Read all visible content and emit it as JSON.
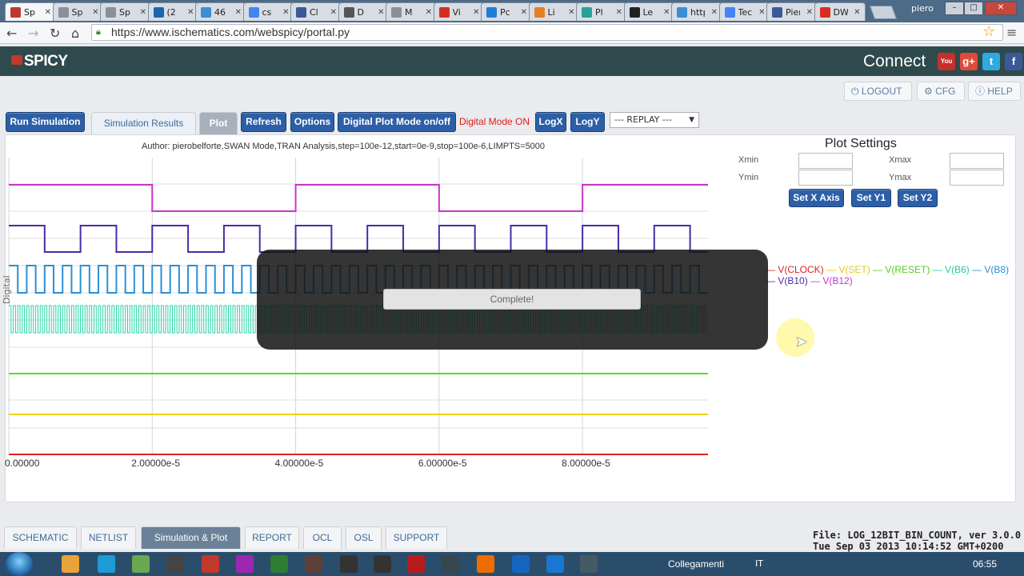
{
  "browser": {
    "tabs": [
      {
        "label": "Sp",
        "color": "#c0392b",
        "active": true
      },
      {
        "label": "Sp",
        "color": "#8a9099"
      },
      {
        "label": "Sp",
        "color": "#8a9099"
      },
      {
        "label": "(2",
        "color": "#1a66b3"
      },
      {
        "label": "46",
        "color": "#3b8ed6"
      },
      {
        "label": "cs",
        "color": "#4285f4"
      },
      {
        "label": "Cl",
        "color": "#3b5998"
      },
      {
        "label": "D",
        "color": "#555555"
      },
      {
        "label": "M",
        "color": "#8a9099"
      },
      {
        "label": "Vi",
        "color": "#d62d20"
      },
      {
        "label": "Pc",
        "color": "#1c7ed6"
      },
      {
        "label": "Li",
        "color": "#e67e22"
      },
      {
        "label": "Pl",
        "color": "#2aa198"
      },
      {
        "label": "Le",
        "color": "#222222"
      },
      {
        "label": "http:",
        "color": "#3b8ed6"
      },
      {
        "label": "Tech",
        "color": "#4285f4"
      },
      {
        "label": "Pierc",
        "color": "#3b5998"
      },
      {
        "label": "DWS",
        "color": "#d62d20"
      }
    ],
    "user": "piero",
    "url": "https://www.ischematics.com/webspicy/portal.py"
  },
  "app": {
    "logo": "SPICY",
    "connect": "Connect",
    "social": [
      {
        "label": "You",
        "color": "#c4302b"
      },
      {
        "label": "g+",
        "color": "#dd4b39"
      },
      {
        "label": "t",
        "color": "#2fa9e0"
      },
      {
        "label": "f",
        "color": "#3b5998"
      }
    ],
    "logout": "LOGOUT",
    "cfg": "CFG",
    "help": "HELP"
  },
  "toolbar": {
    "run": "Run Simulation",
    "results": "Simulation Results",
    "plot": "Plot",
    "refresh": "Refresh",
    "options": "Options",
    "digital": "Digital Plot Mode on/off",
    "digital_status": "Digital Mode ON",
    "logx": "LogX",
    "logy": "LogY",
    "replay": "--- REPLAY ---"
  },
  "plot": {
    "author": "Author: pierobelforte,SWAN Mode,TRAN Analysis,step=100e-12,start=0e-9,stop=100e-6,LIMPTS=5000",
    "ylabel": "Digital",
    "complete": "Complete!"
  },
  "chart_data": {
    "type": "line",
    "title": "",
    "ylabel": "Digital",
    "xlim": [
      0,
      9.75e-05
    ],
    "x_ticks": [
      "0.00000",
      "2.00000e-5",
      "4.00000e-5",
      "6.00000e-5",
      "8.00000e-5"
    ],
    "x_tick_values": [
      0,
      2e-05,
      4e-05,
      6e-05,
      8e-05
    ],
    "series": [
      {
        "name": "V(B12)",
        "color": "#cc33cc",
        "half_period": 2e-05,
        "start_high": true,
        "band": 0
      },
      {
        "name": "V(B10)",
        "color": "#4b2aa8",
        "half_period": 5e-06,
        "start_high": true,
        "band": 1
      },
      {
        "name": "V(B8)",
        "color": "#2b8fd6",
        "half_period": 1.25e-06,
        "start_high": true,
        "band": 2
      },
      {
        "name": "V(B6)",
        "color": "#27d3a3",
        "half_period": 3.125e-07,
        "start_high": true,
        "band": 3
      },
      {
        "name": "V(RESET)",
        "color": "#55dd22",
        "level": "high",
        "band": 4
      },
      {
        "name": "V(SET)",
        "color": "#e8d21a",
        "level": "high",
        "band": 5
      },
      {
        "name": "V(CLOCK)",
        "color": "#dd2222",
        "level": "low",
        "band": 6
      }
    ],
    "grid": true,
    "legend_position": "right"
  },
  "settings": {
    "title": "Plot Settings",
    "xmin_label": "Xmin",
    "xmax_label": "Xmax",
    "ymin_label": "Ymin",
    "ymax_label": "Ymax",
    "set_x": "Set X Axis",
    "set_y1": "Set Y1",
    "set_y2": "Set Y2"
  },
  "legend": {
    "row1": [
      {
        "text": "V(CLOCK)",
        "color": "#dd2222"
      },
      {
        "text": "V(SET)",
        "color": "#e8c81a"
      },
      {
        "text": "V(RESET)",
        "color": "#55cc22"
      },
      {
        "text": "V(B6)",
        "color": "#27c9a0"
      },
      {
        "text": "V(B8)",
        "color": "#2b8fd6"
      }
    ],
    "row2": [
      {
        "text": "V(B10)",
        "color": "#4b2aa8"
      },
      {
        "text": "V(B12)",
        "color": "#cc33cc"
      }
    ]
  },
  "bottom_tabs": {
    "schematic": "SCHEMATIC",
    "netlist": "NETLIST",
    "simplot": "Simulation & Plot",
    "report": "REPORT",
    "ocl": "OCL",
    "osl": "OSL",
    "support": "SUPPORT"
  },
  "file": {
    "line1": "File: LOG_12BIT_BIN_COUNT, ver 3.0.0",
    "line2": "Tue Sep 03 2013 10:14:52 GMT+0200"
  },
  "taskbar": {
    "links": "Collegamenti",
    "lang": "IT",
    "clock": "06:55",
    "apps": [
      "#e8a33a",
      "#1e9bd7",
      "#6aa84f",
      "#444444",
      "#c0392b",
      "#9c27b0",
      "#2e7d32",
      "#5d4037",
      "#333333",
      "#333333",
      "#b71c1c",
      "#37474f",
      "#ef6c00",
      "#1565c0",
      "#1976d2",
      "#455a64"
    ]
  }
}
